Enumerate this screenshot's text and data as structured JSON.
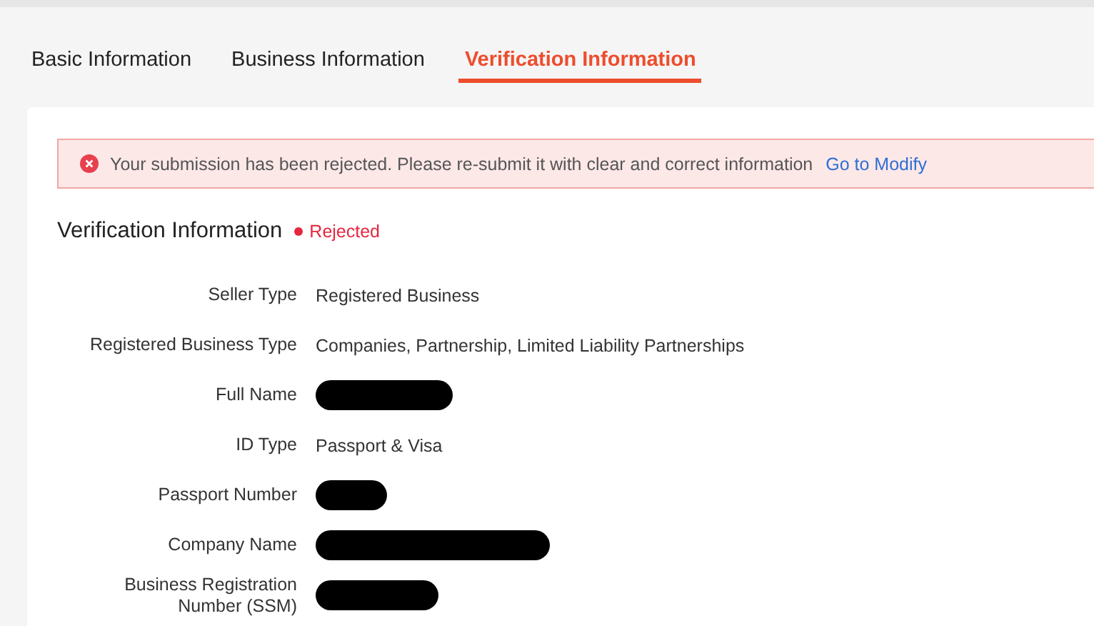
{
  "tabs": [
    {
      "label": "Basic Information",
      "selected": false
    },
    {
      "label": "Business Information",
      "selected": false
    },
    {
      "label": "Verification Information",
      "selected": true
    }
  ],
  "alert": {
    "message": "Your submission has been rejected. Please re-submit it with clear and correct information",
    "link": "Go to Modify"
  },
  "section": {
    "title": "Verification Information",
    "status": "Rejected"
  },
  "fields": [
    {
      "label": "Seller Type",
      "kind": "text",
      "value": "Registered Business"
    },
    {
      "label": "Registered Business Type",
      "kind": "text",
      "value": "Companies, Partnership, Limited Liability Partnerships"
    },
    {
      "label": "Full Name",
      "kind": "redacted"
    },
    {
      "label": "ID Type",
      "kind": "text",
      "value": "Passport & Visa"
    },
    {
      "label": "Passport Number",
      "kind": "redacted"
    },
    {
      "label": "Company Name",
      "kind": "redacted"
    },
    {
      "label": "Business Registration Number (SSM)",
      "kind": "redacted"
    }
  ]
}
